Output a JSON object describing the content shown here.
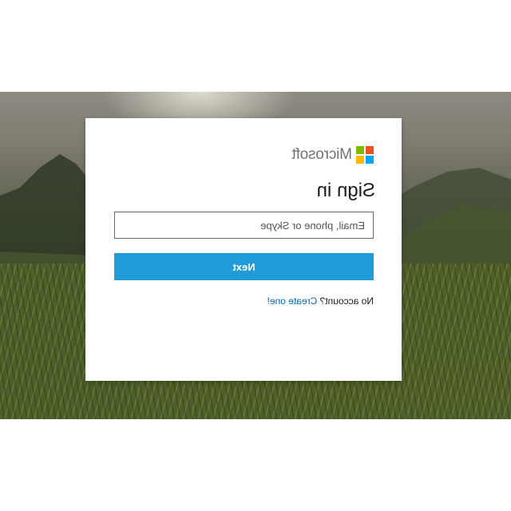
{
  "brand": {
    "name": "Microsoft",
    "logo_colors": {
      "red": "#f25022",
      "green": "#7fba00",
      "blue": "#00a4ef",
      "yellow": "#ffb900"
    }
  },
  "heading": "Sign in",
  "email_field": {
    "placeholder": "Email, phone or Skype",
    "value": ""
  },
  "next_button": {
    "label": "Next"
  },
  "signup": {
    "prompt": "No account?",
    "link": "Create one!"
  },
  "colors": {
    "accent_button": "#1f9bd7",
    "link": "#0067b8",
    "brand_text": "#737373"
  },
  "background": {
    "scene": "mountain-grassland-photo"
  }
}
